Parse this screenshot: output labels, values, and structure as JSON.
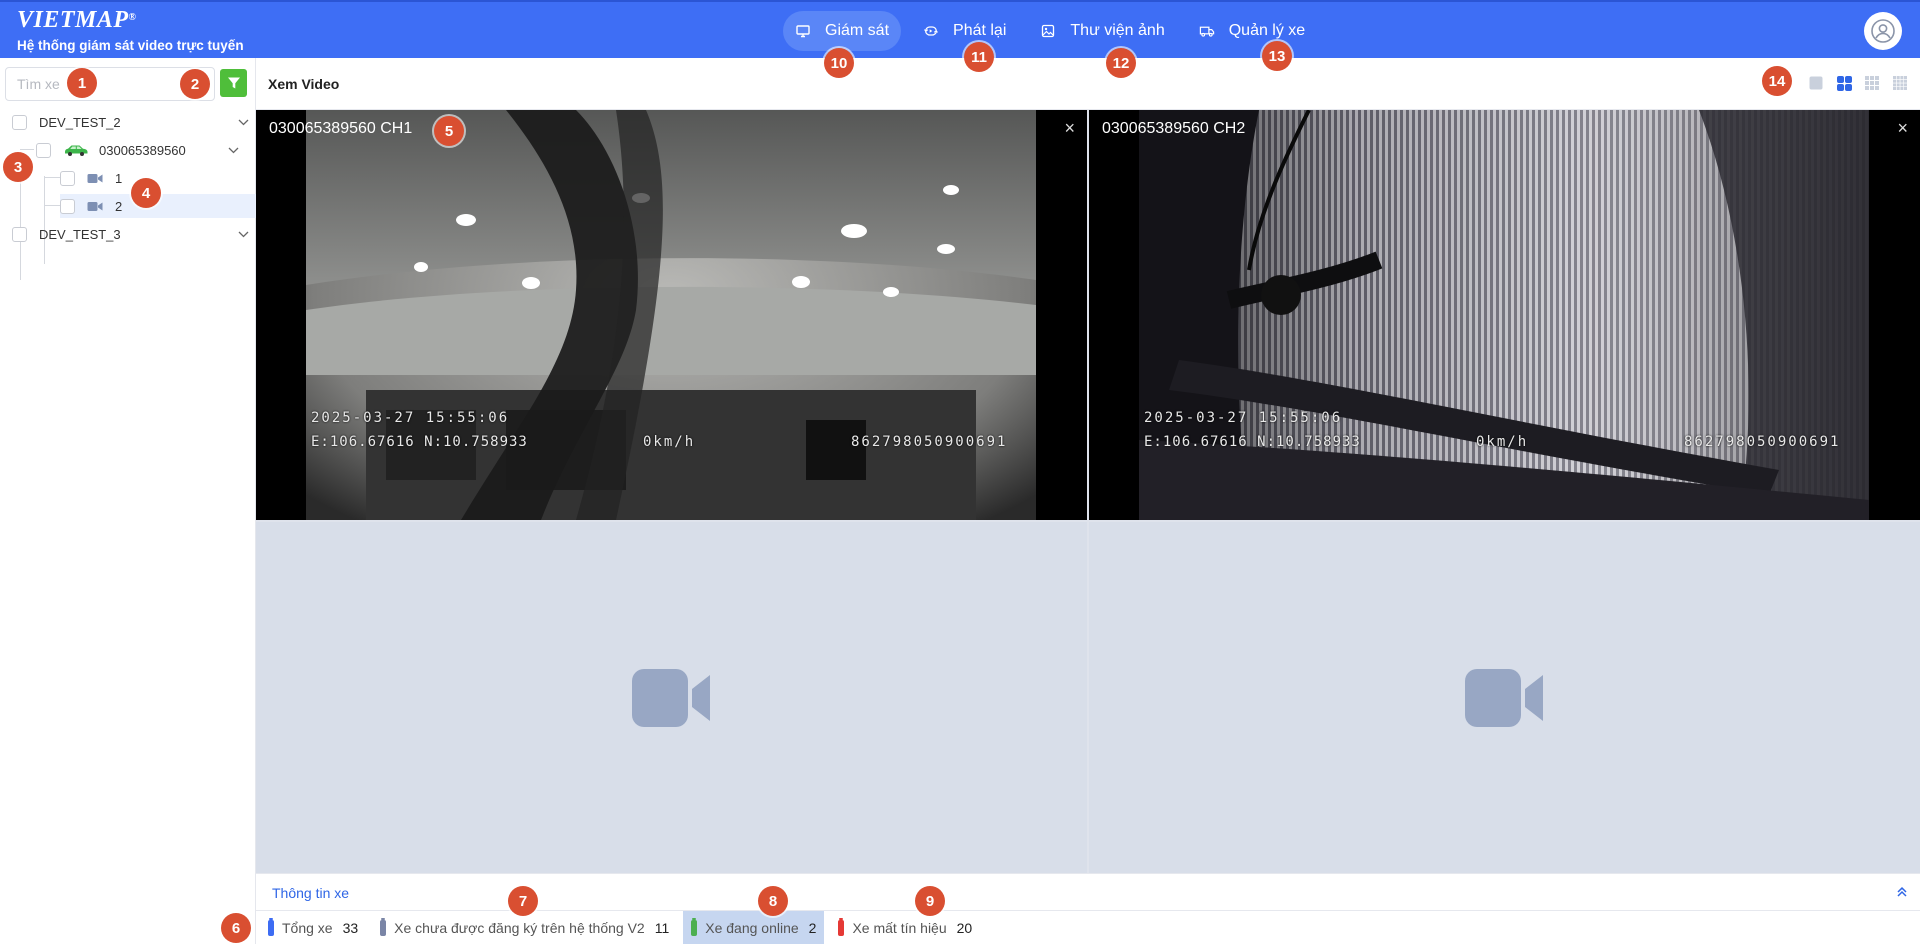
{
  "header": {
    "logo_text": "VIETMAP",
    "logo_reg": "®",
    "tagline": "Hệ thống giám sát video trực tuyến",
    "nav": [
      {
        "label": "Giám sát",
        "icon": "monitor-icon",
        "active": true
      },
      {
        "label": "Phát lại",
        "icon": "playback-icon",
        "active": false
      },
      {
        "label": "Thư viện ảnh",
        "icon": "image-icon",
        "active": false
      },
      {
        "label": "Quản lý xe",
        "icon": "truck-icon",
        "active": false
      }
    ],
    "user_icon": "user-avatar-icon"
  },
  "sidebar": {
    "search_placeholder": "Tìm xe",
    "filter_icon": "filter-icon",
    "tree": [
      {
        "label": "DEV_TEST_2",
        "level": 0,
        "expanded": true
      },
      {
        "label": "030065389560",
        "level": 1,
        "icon": "car-icon",
        "expanded": true
      },
      {
        "label": "1",
        "level": 2,
        "icon": "camera-icon"
      },
      {
        "label": "2",
        "level": 2,
        "icon": "camera-icon",
        "selected": true
      },
      {
        "label": "DEV_TEST_3",
        "level": 0,
        "expanded": true
      }
    ]
  },
  "main": {
    "title": "Xem Video",
    "layouts": [
      "layout-1",
      "layout-4",
      "layout-9",
      "layout-16"
    ],
    "active_layout": "layout-4",
    "cells": [
      {
        "title": "030065389560 CH1",
        "has_video": true,
        "osd_time": "2025-03-27 15:55:06",
        "osd_coords": "E:106.67616 N:10.758933",
        "osd_speed": "0km/h",
        "osd_id": "862798050900691"
      },
      {
        "title": "030065389560 CH2",
        "has_video": true,
        "osd_time": "2025-03-27 15:55:06",
        "osd_coords": "E:106.67616 N:10.758933",
        "osd_speed": "0km/h",
        "osd_id": "862798050900691"
      },
      {
        "has_video": false,
        "icon": "video-camera-icon"
      },
      {
        "has_video": false,
        "icon": "video-camera-icon"
      }
    ],
    "close_glyph": "×"
  },
  "info_panel": {
    "title": "Thông tin xe"
  },
  "status": [
    {
      "label": "Tổng xe",
      "count": "33",
      "color": "#3d6cf3"
    },
    {
      "label": "Xe chưa được đăng ký trên hệ thống V2",
      "count": "11",
      "color": "#7a85a6"
    },
    {
      "label": "Xe đang online",
      "count": "2",
      "color": "#4caf50",
      "highlighted": true
    },
    {
      "label": "Xe mất tín hiệu",
      "count": "20",
      "color": "#e53935"
    }
  ],
  "markers": [
    "1",
    "2",
    "3",
    "4",
    "5",
    "6",
    "7",
    "8",
    "9",
    "10",
    "11",
    "12",
    "13",
    "14"
  ],
  "colors": {
    "topbar": "#3e6ef5",
    "accent": "#2f66e6",
    "filter": "#4fbe3a",
    "marker": "#d94f31"
  }
}
